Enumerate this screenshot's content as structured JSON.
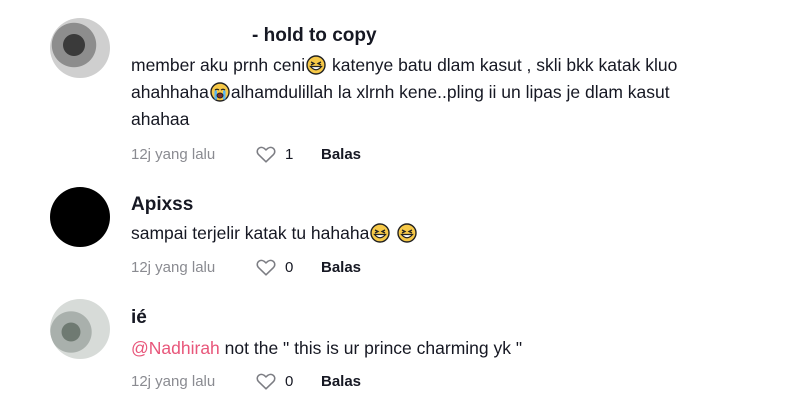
{
  "comments": [
    {
      "name": "- hold to copy",
      "line1a": "member aku prnh ceni",
      "line1b": " katenye batu dlam kasut , skli bkk katak kluo",
      "line2a": "ahahhaha",
      "line2b": "alhamdulillah la xlrnh kene..pling ii un lipas je dlam kasut",
      "line3": "ahahaa",
      "time": "12j yang lalu",
      "likes": "1",
      "reply": "Balas"
    },
    {
      "name": "Apixss",
      "line1": "sampai terjelir katak tu hahaha",
      "time": "12j yang lalu",
      "likes": "0",
      "reply": "Balas"
    },
    {
      "name": "ié",
      "mention": "@Nadhirah",
      "line1": " not the \" this is ur prince charming yk \"",
      "time": "12j yang lalu",
      "likes": "0",
      "reply": "Balas"
    }
  ],
  "icons": {
    "laugh": "grinning-squinting-face-icon",
    "cry": "loudly-crying-face-icon",
    "heart": "heart-outline-icon"
  },
  "colors": {
    "mention": "#e8567a",
    "meta": "#8a8b91",
    "text": "#161823"
  }
}
